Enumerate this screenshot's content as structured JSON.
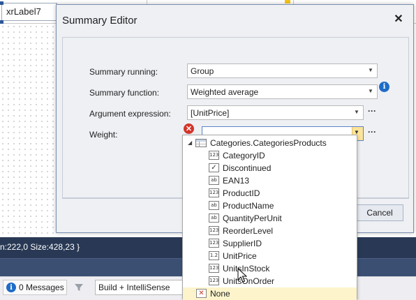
{
  "designer": {
    "label_text": "xrLabel7"
  },
  "status_bar": {
    "text": "n:222,0 Size:428,23 }"
  },
  "bottom_toolbar": {
    "messages_label": "0 Messages",
    "build_option": "Build + IntelliSense"
  },
  "dialog": {
    "title": "Summary Editor",
    "close_glyph": "✕",
    "rows": {
      "running": {
        "label": "Summary running:",
        "value": "Group"
      },
      "function": {
        "label": "Summary function:",
        "value": "Weighted average"
      },
      "argument": {
        "label": "Argument expression:",
        "value": "[UnitPrice]"
      },
      "weight": {
        "label": "Weight:",
        "value": ""
      }
    },
    "cancel_label": "Cancel"
  },
  "popup": {
    "root": {
      "label": "Categories.CategoriesProducts",
      "icon": "table-icon"
    },
    "items": [
      {
        "label": "CategoryID",
        "icon": "123"
      },
      {
        "label": "Discontinued",
        "icon": "✓"
      },
      {
        "label": "EAN13",
        "icon": "ab"
      },
      {
        "label": "ProductID",
        "icon": "123"
      },
      {
        "label": "ProductName",
        "icon": "ab"
      },
      {
        "label": "QuantityPerUnit",
        "icon": "ab"
      },
      {
        "label": "ReorderLevel",
        "icon": "123"
      },
      {
        "label": "SupplierID",
        "icon": "123"
      },
      {
        "label": "UnitPrice",
        "icon": "1.2"
      },
      {
        "label": "UnitsInStock",
        "icon": "123"
      },
      {
        "label": "UnitsOnOrder",
        "icon": "123"
      }
    ],
    "none": {
      "label": "None",
      "icon": "✕"
    }
  },
  "colors": {
    "status_bar": "#293955",
    "accent_blue": "#1e6cc8",
    "error_red": "#d2352a",
    "dropdown_highlight": "#fde49a"
  }
}
